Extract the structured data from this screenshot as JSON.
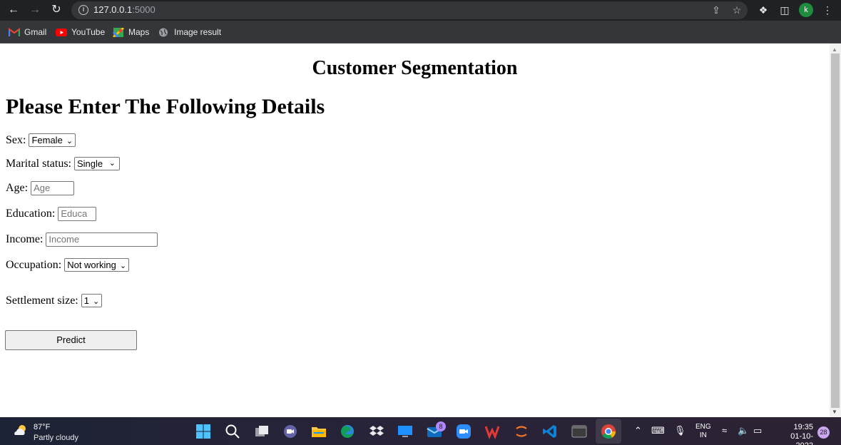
{
  "browser": {
    "url_host": "127.0.0.1",
    "url_port": ":5000",
    "profile_initial": "k",
    "bookmarks": [
      {
        "label": "Gmail",
        "icon": "gmail-icon"
      },
      {
        "label": "YouTube",
        "icon": "youtube-icon"
      },
      {
        "label": "Maps",
        "icon": "maps-icon"
      },
      {
        "label": "Image result",
        "icon": "globe-icon"
      }
    ]
  },
  "page": {
    "title": "Customer Segmentation",
    "form_heading": "Please Enter The Following Details",
    "fields": {
      "sex": {
        "label": "Sex:",
        "value": "Female"
      },
      "marital": {
        "label": "Marital status:",
        "value": "Single"
      },
      "age": {
        "label": "Age:",
        "placeholder": "Age"
      },
      "education": {
        "label": "Education:",
        "placeholder": "Educa"
      },
      "income": {
        "label": "Income:",
        "placeholder": "Income"
      },
      "occupation": {
        "label": "Occupation:",
        "value": "Not working"
      },
      "settlement": {
        "label": "Settlement size:",
        "value": "1"
      }
    },
    "submit_label": "Predict"
  },
  "taskbar": {
    "weather_temp": "87°F",
    "weather_desc": "Partly cloudy",
    "mail_badge": "8",
    "lang_line1": "ENG",
    "lang_line2": "IN",
    "time": "19:35",
    "date": "01-10-2022",
    "notification_count": "28"
  },
  "colors": {
    "chrome_dark": "#202124",
    "bookmarks_bar": "#35363a",
    "profile_green": "#1e8e3e",
    "button_gray": "#efefef"
  }
}
